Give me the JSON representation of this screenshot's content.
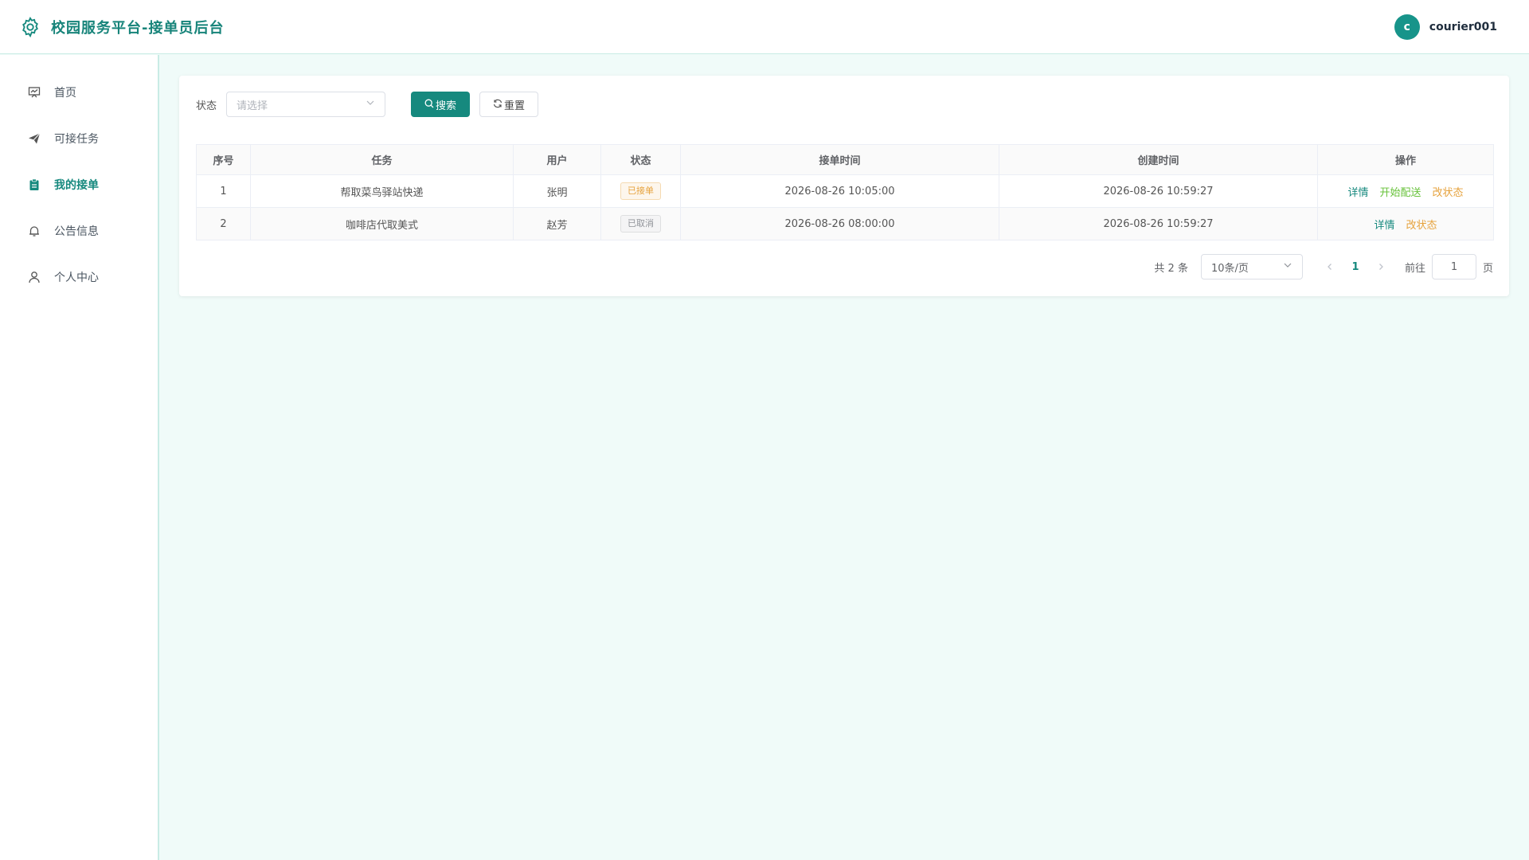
{
  "header": {
    "title": "校园服务平台-接单员后台",
    "avatar_letter": "c",
    "username": "courier001"
  },
  "sidebar": {
    "items": [
      {
        "label": "首页",
        "icon": "home-chart-icon"
      },
      {
        "label": "可接任务",
        "icon": "send-icon"
      },
      {
        "label": "我的接单",
        "icon": "clipboard-icon",
        "active": true
      },
      {
        "label": "公告信息",
        "icon": "bell-icon"
      },
      {
        "label": "个人中心",
        "icon": "user-icon"
      }
    ]
  },
  "filter": {
    "status_label": "状态",
    "status_placeholder": "请选择",
    "search_label": "搜索",
    "reset_label": "重置"
  },
  "table": {
    "columns": [
      "序号",
      "任务",
      "用户",
      "状态",
      "接单时间",
      "创建时间",
      "操作"
    ],
    "rows": [
      {
        "index": "1",
        "task": "帮取菜鸟驿站快递",
        "user": "张明",
        "status": "已接单",
        "accept_time": "2026-08-26 10:05:00",
        "create_time": "2026-08-26 10:59:27",
        "actions": [
          "详情",
          "开始配送",
          "改状态"
        ]
      },
      {
        "index": "2",
        "task": "咖啡店代取美式",
        "user": "赵芳",
        "status": "已取消",
        "accept_time": "2026-08-26 08:00:00",
        "create_time": "2026-08-26 10:59:27",
        "actions": [
          "详情",
          "改状态"
        ]
      }
    ]
  },
  "pagination": {
    "total": "共 2 条",
    "page_size": "10条/页",
    "current_page": "1",
    "goto_label": "前往",
    "goto_value": "1",
    "page_unit": "页"
  },
  "colors": {
    "primary": "#16897e",
    "background": "#f0fbf9",
    "warning": "#e6a23c",
    "success": "#67c23a"
  }
}
